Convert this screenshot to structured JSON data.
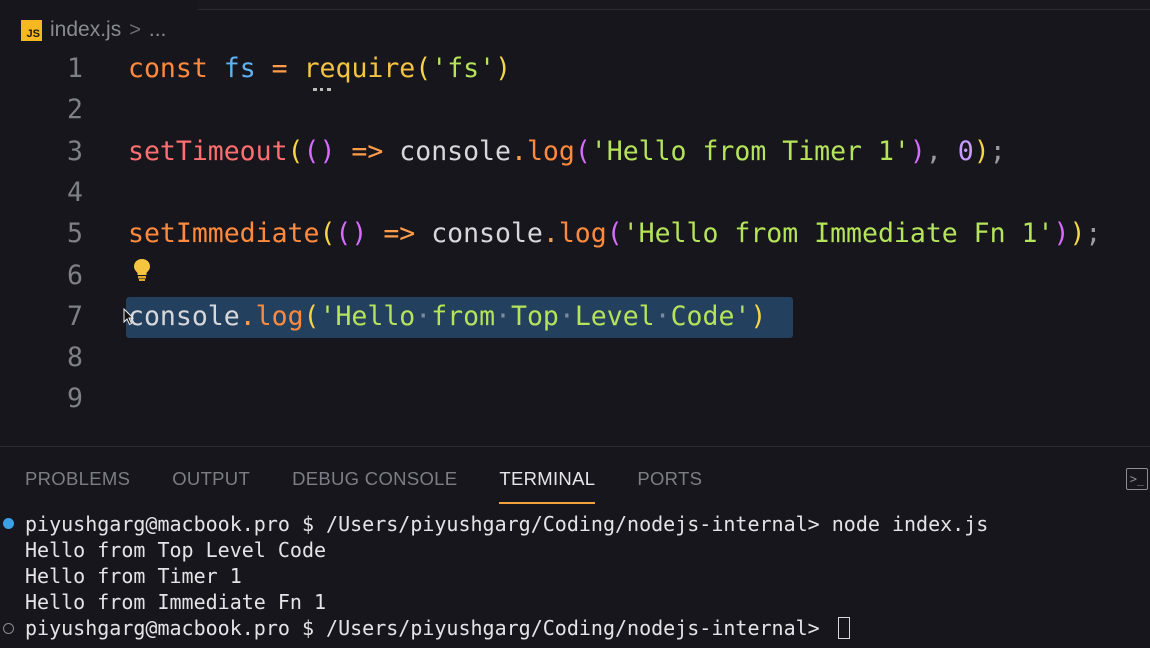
{
  "breadcrumb": {
    "file_icon": "JS",
    "file": "index.js",
    "separator": ">",
    "more": "..."
  },
  "editor": {
    "lines": [
      {
        "n": "1",
        "tokens": [
          [
            "kw",
            "const"
          ],
          [
            "plain",
            " "
          ],
          [
            "var",
            "fs"
          ],
          [
            "plain",
            " "
          ],
          [
            "op",
            "="
          ],
          [
            "plain",
            " "
          ],
          [
            "fn2",
            "require"
          ],
          [
            "paren2",
            "("
          ],
          [
            "str",
            "'fs'"
          ],
          [
            "paren2",
            ")"
          ]
        ]
      },
      {
        "n": "2",
        "tokens": []
      },
      {
        "n": "3",
        "tokens": [
          [
            "fnT",
            "setTimeout"
          ],
          [
            "paren2",
            "("
          ],
          [
            "paren",
            "()"
          ],
          [
            "plain",
            " "
          ],
          [
            "op",
            "=>"
          ],
          [
            "plain",
            " console"
          ],
          [
            "op",
            "."
          ],
          [
            "fn",
            "log"
          ],
          [
            "paren",
            "("
          ],
          [
            "str",
            "'Hello from Timer 1'"
          ],
          [
            "paren",
            ")"
          ],
          [
            "punc",
            ", "
          ],
          [
            "num",
            "0"
          ],
          [
            "paren2",
            ")"
          ],
          [
            "punc",
            ";"
          ]
        ]
      },
      {
        "n": "4",
        "tokens": []
      },
      {
        "n": "5",
        "tokens": [
          [
            "fn",
            "setImmediate"
          ],
          [
            "paren2",
            "("
          ],
          [
            "paren",
            "()"
          ],
          [
            "plain",
            " "
          ],
          [
            "op",
            "=>"
          ],
          [
            "plain",
            " console"
          ],
          [
            "op",
            "."
          ],
          [
            "fn",
            "log"
          ],
          [
            "paren",
            "("
          ],
          [
            "str",
            "'Hello from Immediate Fn 1'"
          ],
          [
            "paren",
            ")"
          ],
          [
            "paren2",
            ")"
          ],
          [
            "punc",
            ";"
          ]
        ]
      },
      {
        "n": "6",
        "tokens": []
      },
      {
        "n": "7",
        "tokens": [
          [
            "plain",
            "console"
          ],
          [
            "op",
            "."
          ],
          [
            "fn",
            "log"
          ],
          [
            "paren2",
            "("
          ],
          [
            "str",
            "'Hello·from·Top·Level·Code'"
          ],
          [
            "paren2",
            ")"
          ]
        ]
      },
      {
        "n": "8",
        "tokens": []
      },
      {
        "n": "9",
        "tokens": []
      }
    ]
  },
  "panel": {
    "tabs": [
      "PROBLEMS",
      "OUTPUT",
      "DEBUG CONSOLE",
      "TERMINAL",
      "PORTS"
    ],
    "active_tab": "TERMINAL",
    "terminal_lines": [
      "piyushgarg@macbook.pro $ /Users/piyushgarg/Coding/nodejs-internal> node index.js",
      "Hello from Top Level Code",
      "Hello from Timer 1",
      "Hello from Immediate Fn 1",
      "piyushgarg@macbook.pro $ /Users/piyushgarg/Coding/nodejs-internal> "
    ]
  },
  "icons": [
    "js-file-icon",
    "lightbulb-icon",
    "terminal-icon",
    "mouse-cursor-icon"
  ],
  "colors": {
    "accent": "#f2a23c",
    "selection": "#23405e",
    "string": "#b5e35a"
  }
}
